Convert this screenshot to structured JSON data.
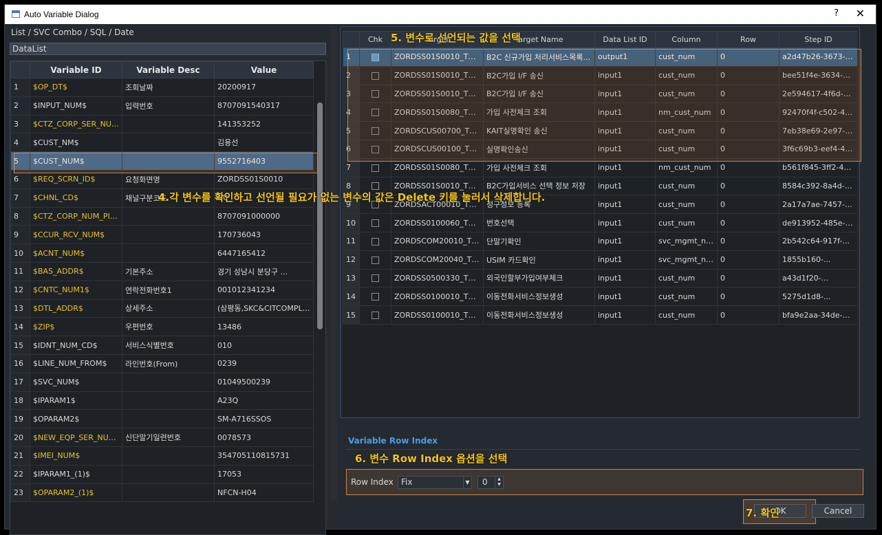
{
  "window": {
    "title": "Auto Variable Dialog",
    "help_label": "?",
    "close_label": "✕"
  },
  "left_panel": {
    "header": "List / SVC Combo / SQL / Date",
    "datalist_label": "DataList",
    "columns": [
      "Variable ID",
      "Variable Desc",
      "Value"
    ],
    "rows": [
      {
        "n": "1",
        "id": "$OP_DT$",
        "desc": "조회날짜",
        "value": "20200917",
        "hl": true
      },
      {
        "n": "2",
        "id": "$INPUT_NUM$",
        "desc": "입력번호",
        "value": "8707091540317",
        "hl": false
      },
      {
        "n": "3",
        "id": "$CTZ_CORP_SER_NUM$",
        "desc": "",
        "value": "141353252",
        "hl": true
      },
      {
        "n": "4",
        "id": "$CUST_NM$",
        "desc": "",
        "value": "김용선",
        "hl": false
      },
      {
        "n": "5",
        "id": "$CUST_NUM$",
        "desc": "",
        "value": "9552716403",
        "hl": false,
        "selected": true
      },
      {
        "n": "6",
        "id": "$REQ_SCRN_ID$",
        "desc": "요청화면명",
        "value": "ZORDSS01S0010",
        "hl": true
      },
      {
        "n": "7",
        "id": "$CHNL_CD$",
        "desc": "채널구분코드",
        "value": "N0",
        "hl": true
      },
      {
        "n": "8",
        "id": "$CTZ_CORP_NUM_PINF$",
        "desc": "",
        "value": "8707091000000",
        "hl": true
      },
      {
        "n": "9",
        "id": "$CCUR_RCV_NUM$",
        "desc": "",
        "value": "170736043",
        "hl": true
      },
      {
        "n": "10",
        "id": "$ACNT_NUM$",
        "desc": "",
        "value": "6447165412",
        "hl": true
      },
      {
        "n": "11",
        "id": "$BAS_ADDR$",
        "desc": "기본주소",
        "value": "경기 성남시 분당구 ...",
        "hl": true
      },
      {
        "n": "12",
        "id": "$CNTC_NUM1$",
        "desc": "연락전화번호1",
        "value": "001012341234",
        "hl": true
      },
      {
        "n": "13",
        "id": "$DTL_ADDR$",
        "desc": "상세주소",
        "value": "(삼평동,SKC&CITCOMPLEX)",
        "hl": true
      },
      {
        "n": "14",
        "id": "$ZIP$",
        "desc": "우편번호",
        "value": "13486",
        "hl": true
      },
      {
        "n": "15",
        "id": "$IDNT_NUM_CD$",
        "desc": "서비스식별번호",
        "value": "010",
        "hl": false
      },
      {
        "n": "16",
        "id": "$LINE_NUM_FROM$",
        "desc": "라인번호(From)",
        "value": "0239",
        "hl": false
      },
      {
        "n": "17",
        "id": "$SVC_NUM$",
        "desc": "",
        "value": "01049500239",
        "hl": false
      },
      {
        "n": "18",
        "id": "$IPARAM1$",
        "desc": "",
        "value": "A23Q",
        "hl": false
      },
      {
        "n": "19",
        "id": "$OPARAM2$",
        "desc": "",
        "value": "SM-A716SSOS",
        "hl": false
      },
      {
        "n": "20",
        "id": "$NEW_EQP_SER_NUM$",
        "desc": "신단말기일련번호",
        "value": "0078573",
        "hl": true
      },
      {
        "n": "21",
        "id": "$IMEI_NUM$",
        "desc": "",
        "value": "354705110815731",
        "hl": true
      },
      {
        "n": "22",
        "id": "$IPARAM1_(1)$",
        "desc": "",
        "value": "17053",
        "hl": false
      },
      {
        "n": "23",
        "id": "$OPARAM2_(1)$",
        "desc": "",
        "value": "NFCN-H04",
        "hl": true
      }
    ]
  },
  "right_panel": {
    "columns": [
      "",
      "Chk",
      "Target",
      "Target Name",
      "Data List ID",
      "Column",
      "Row",
      "Step ID"
    ],
    "rows": [
      {
        "n": "1",
        "chk": true,
        "target": "ZORDSS01S0010_TR01",
        "name": "B2C 신규가입 처리서비스목록...",
        "dl": "output1",
        "col": "cust_num",
        "row": "0",
        "step": "a2d47b26-3673-49...",
        "selected": true
      },
      {
        "n": "2",
        "chk": false,
        "target": "ZORDSS01S0010_TR05",
        "name": "B2C가입 I/F 송신",
        "dl": "input1",
        "col": "cust_num",
        "row": "0",
        "step": "bee51f4e-3634-4a3..."
      },
      {
        "n": "3",
        "chk": false,
        "target": "ZORDSS01S0010_TR05",
        "name": "B2C가입 I/F 송신",
        "dl": "input1",
        "col": "cust_num",
        "row": "0",
        "step": "2e594617-4f6d-41..."
      },
      {
        "n": "4",
        "chk": false,
        "target": "ZORDSS01S0080_TR03",
        "name": "가입 사전체크 조회",
        "dl": "input1",
        "col": "nm_cust_num",
        "row": "0",
        "step": "92470f4f-c502-4ef..."
      },
      {
        "n": "5",
        "chk": false,
        "target": "ZORDSCUS00700_TR02",
        "name": "KAIT실명확인 송신",
        "dl": "input1",
        "col": "cust_num",
        "row": "0",
        "step": "7eb38e69-2e97-46..."
      },
      {
        "n": "6",
        "chk": false,
        "target": "ZORDSCUS00100_TR03",
        "name": "실명확인송신",
        "dl": "input1",
        "col": "cust_num",
        "row": "0",
        "step": "3f6c69b3-eef4-4d8..."
      },
      {
        "n": "7",
        "chk": false,
        "target": "ZORDSS01S0080_TR03",
        "name": "가입 사전체크 조회",
        "dl": "input1",
        "col": "nm_cust_num",
        "row": "0",
        "step": "b561f845-3ff2-449..."
      },
      {
        "n": "8",
        "chk": false,
        "target": "ZORDSS01S0010_TR04",
        "name": "B2C가입서비스 선택 정보 저장",
        "dl": "input1",
        "col": "cust_num",
        "row": "0",
        "step": "8584c392-8a4d-49..."
      },
      {
        "n": "9",
        "chk": false,
        "target": "ZORDSACT00010_TR01",
        "name": "청구정보 등록",
        "dl": "input1",
        "col": "cust_num",
        "row": "0",
        "step": "2a17a7ae-7457-4a..."
      },
      {
        "n": "10",
        "chk": false,
        "target": "ZORDSS0100060_TR01",
        "name": "번호선택",
        "dl": "input1",
        "col": "cust_num",
        "row": "0",
        "step": "de913952-485e-47..."
      },
      {
        "n": "11",
        "chk": false,
        "target": "ZORDSCOM20010_TR01",
        "name": "단말기확인",
        "dl": "input1",
        "col": "svc_mgmt_num",
        "row": "0",
        "step": "2b542c64-917f-4c..."
      },
      {
        "n": "12",
        "chk": false,
        "target": "ZORDSCOM20040_TR01",
        "name": "USIM 카드확인",
        "dl": "input1",
        "col": "svc_mgmt_num",
        "row": "0",
        "step": "1855b160-..."
      },
      {
        "n": "13",
        "chk": false,
        "target": "ZORDSS0500330_TR05",
        "name": "외국인할부가입여부체크",
        "dl": "input1",
        "col": "cust_num",
        "row": "0",
        "step": "a43d1f20-..."
      },
      {
        "n": "14",
        "chk": false,
        "target": "ZORDSS0100010_TR02",
        "name": "이동전화서비스정보생성",
        "dl": "input1",
        "col": "cust_num",
        "row": "0",
        "step": "5275d1d8-..."
      },
      {
        "n": "15",
        "chk": false,
        "target": "ZORDSS0100010_TR02",
        "name": "이동전화서비스정보생성",
        "dl": "input1",
        "col": "cust_num",
        "row": "0",
        "step": "bfa9e2aa-34de-454..."
      }
    ]
  },
  "variable_row_index": {
    "section_title": "Variable Row Index",
    "label": "Row Index",
    "select_value": "Fix",
    "spin_value": "0"
  },
  "buttons": {
    "ok": "OK",
    "cancel": "Cancel"
  },
  "annotations": {
    "a4": "4.각 변수를 확인하고 선언될 필요가 없는 변수의 값은 Delete 키를 눌러서 삭제합니다.",
    "a5": "5. 변수로 선언되는 값을 선택",
    "a6": "6. 변수 Row Index 옵션을 선택",
    "a7": "7. 확인"
  },
  "colors": {
    "highlight_text": "#e8c12a",
    "annotation": "#f5c518",
    "selection": "#3a6a9a",
    "accent_blue": "#4a9ee6"
  }
}
